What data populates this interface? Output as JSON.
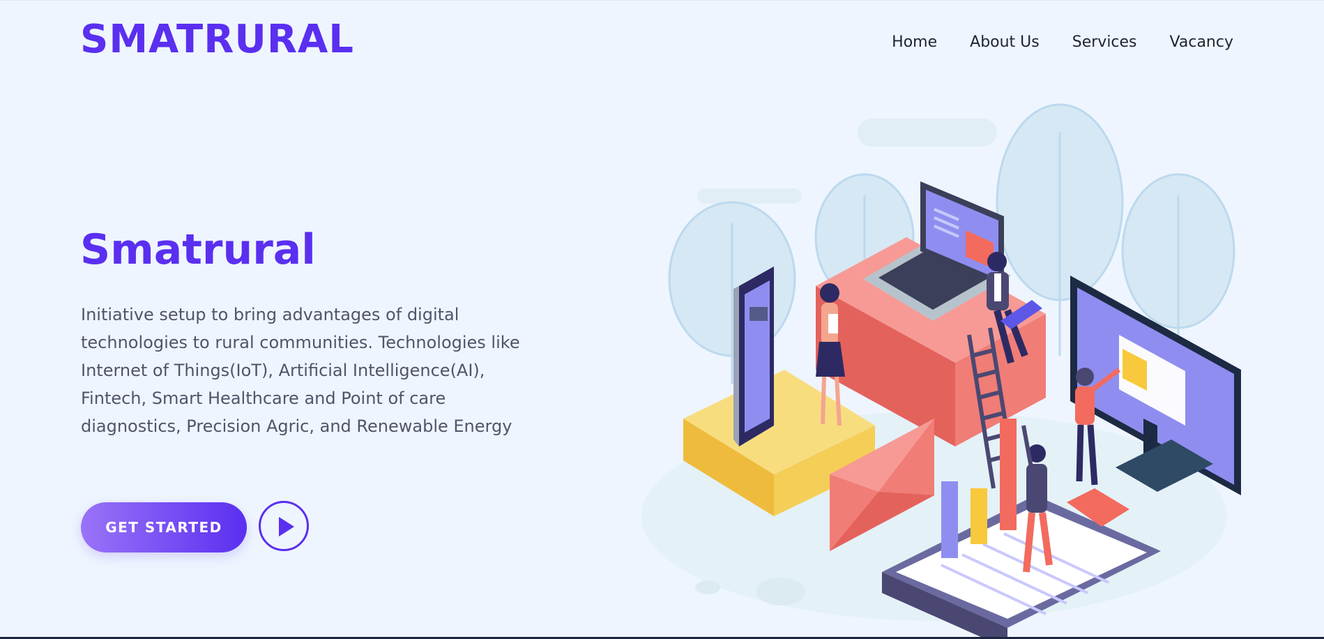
{
  "header": {
    "logo": "SMATRURAL",
    "nav": [
      "Home",
      "About Us",
      "Services",
      "Vacancy"
    ]
  },
  "hero": {
    "title": "Smatrural",
    "description": "Initiative setup to bring advantages of digital technologies to rural communities. Technologies like Internet of Things(IoT), Artificial Intelligence(AI), Fintech, Smart Healthcare and Point of care diagnostics, Precision Agric, and Renewable Energy",
    "cta_label": "GET STARTED",
    "play_icon": "play-icon"
  },
  "colors": {
    "brand": "#5a2ff0",
    "background": "#eef5fe",
    "text": "#52546a",
    "nav_text": "#1f2331"
  }
}
